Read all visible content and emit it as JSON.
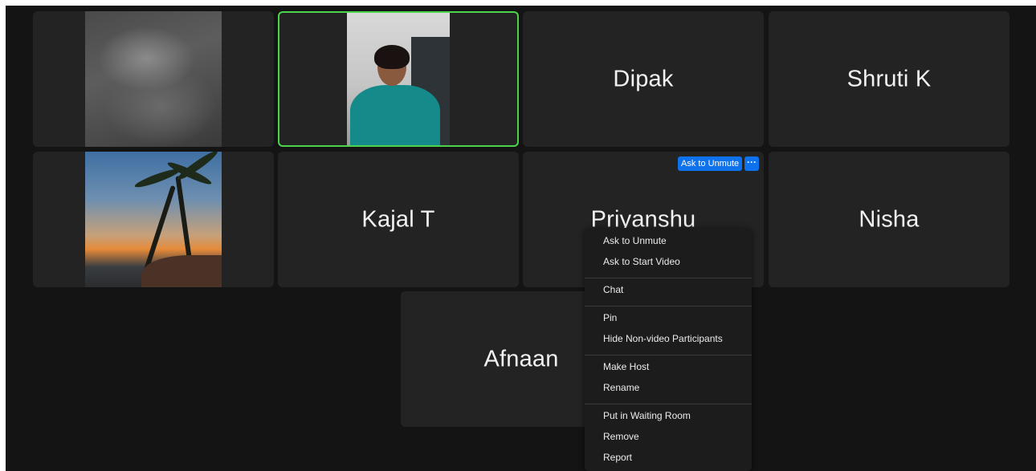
{
  "participants": {
    "dipak": "Dipak",
    "shruti": "Shruti K",
    "kajal": "Kajal T",
    "priyanshu": "Priyanshu",
    "nisha": "Nisha",
    "afnaan": "Afnaan"
  },
  "hover_controls": {
    "ask_to_unmute": "Ask to Unmute",
    "more": "···"
  },
  "context_menu": {
    "items": [
      "Ask to Unmute",
      "Ask to Start Video",
      "Chat",
      "Pin",
      "Hide Non-video Participants",
      "Make Host",
      "Rename",
      "Put in Waiting Room",
      "Remove",
      "Report"
    ]
  },
  "colors": {
    "active_speaker_border": "#4bd44b",
    "accent_blue": "#0e72ed",
    "background": "#141414",
    "tile": "#232323"
  }
}
